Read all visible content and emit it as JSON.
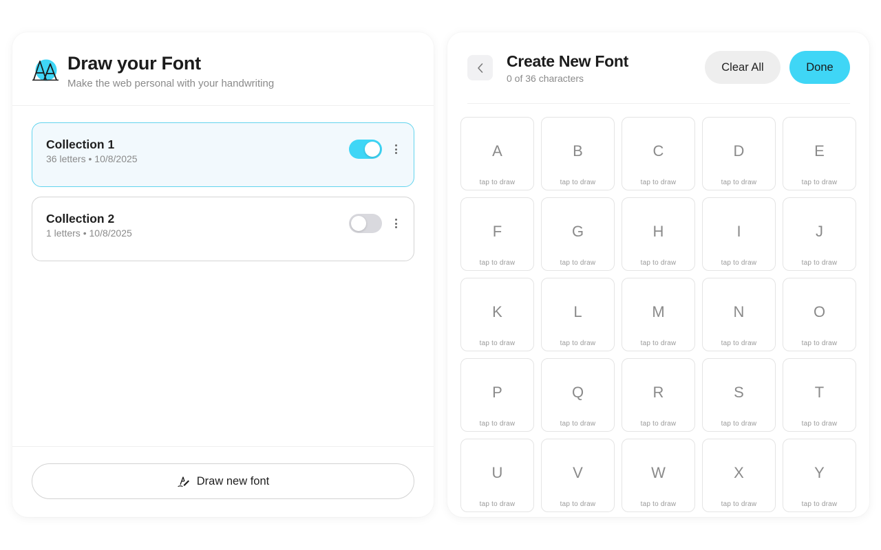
{
  "app": {
    "title": "Draw your Font",
    "subtitle": "Make the web personal with your handwriting",
    "logo_icon": "aa-logo-icon",
    "accent_color": "#3fd6f6"
  },
  "collections": [
    {
      "name": "Collection 1",
      "letters": "36 letters",
      "date": "10/8/2025",
      "enabled": true
    },
    {
      "name": "Collection 2",
      "letters": "1 letters",
      "date": "10/8/2025",
      "enabled": false
    }
  ],
  "footer": {
    "draw_new_label": "Draw new font",
    "draw_new_icon": "pen-signature-icon"
  },
  "editor": {
    "title": "Create New Font",
    "count_text": "0 of 36 characters",
    "clear_label": "Clear All",
    "done_label": "Done",
    "back_icon": "chevron-left-icon",
    "cell_hint": "tap to draw",
    "characters": [
      "A",
      "B",
      "C",
      "D",
      "E",
      "F",
      "G",
      "H",
      "I",
      "J",
      "K",
      "L",
      "M",
      "N",
      "O",
      "P",
      "Q",
      "R",
      "S",
      "T",
      "U",
      "V",
      "W",
      "X",
      "Y"
    ]
  }
}
